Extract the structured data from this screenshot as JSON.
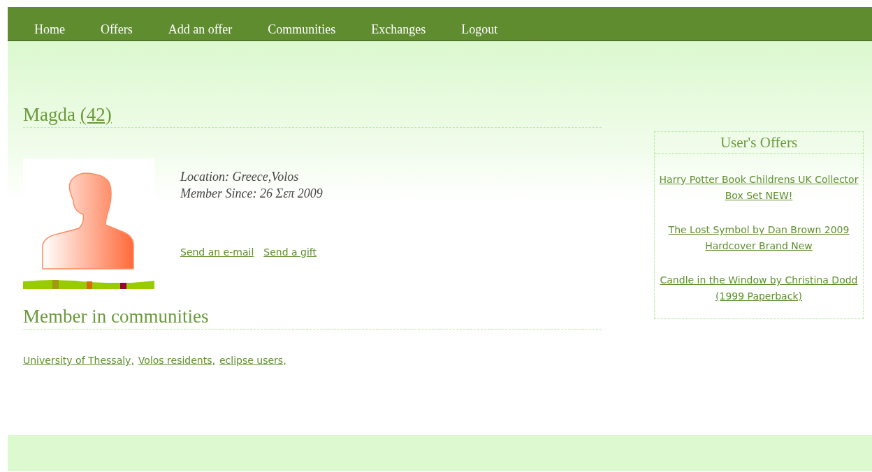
{
  "nav": [
    {
      "label": "Home"
    },
    {
      "label": "Offers"
    },
    {
      "label": "Add an offer"
    },
    {
      "label": "Communities"
    },
    {
      "label": "Exchanges"
    },
    {
      "label": "Logout"
    }
  ],
  "profile": {
    "name": "Magda",
    "count": "(42)",
    "location": "Location: Greece,Volos",
    "member_since": "Member Since: 26 Σεπ 2009",
    "actions": [
      "Send an e-mail",
      "Send a gift"
    ]
  },
  "communities": {
    "title": "Member in communities",
    "items": [
      "University of Thessaly,",
      "Volos residents,",
      "eclipse users,"
    ]
  },
  "offers": {
    "title": "User's Offers",
    "items": [
      "Harry Potter Book Childrens UK Collector Box Set NEW!",
      "The Lost Symbol by Dan Brown 2009 Hardcover Brand New",
      "Candle in the Window by Christina Dodd (1999 Paperback)"
    ]
  }
}
